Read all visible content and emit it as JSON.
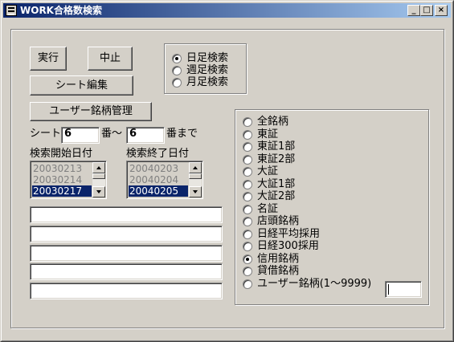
{
  "window": {
    "title": "WORK合格数検索",
    "minimize_glyph": "_",
    "maximize_glyph": "□",
    "close_glyph": "×"
  },
  "buttons": {
    "run": "実行",
    "stop": "中止",
    "sheet_edit": "シート編集",
    "user_stock_manage": "ユーザー銘柄管理"
  },
  "period": {
    "options": [
      "日足検索",
      "週足検索",
      "月足検索"
    ],
    "selected_index": 0
  },
  "sheet_range": {
    "label_prefix": "シート",
    "from_value": "6",
    "mid_label": "番～",
    "to_value": "6",
    "suffix": "番まで"
  },
  "start_date": {
    "label": "検索開始日付",
    "items": [
      "20030213",
      "20030214",
      "20030217"
    ],
    "selected_index": 2
  },
  "end_date": {
    "label": "検索終了日付",
    "items": [
      "20040203",
      "20040204",
      "20040205"
    ],
    "selected_index": 2
  },
  "text_fields": [
    "",
    "",
    "",
    "",
    ""
  ],
  "market": {
    "options": [
      "全銘柄",
      "東証",
      "東証1部",
      "東証2部",
      "大証",
      "大証1部",
      "大証2部",
      "名証",
      "店頭銘柄",
      "日経平均採用",
      "日経300採用",
      "信用銘柄",
      "貸借銘柄",
      "ユーザー銘柄(1～9999)"
    ],
    "selected_index": 11,
    "user_code_value": ""
  }
}
